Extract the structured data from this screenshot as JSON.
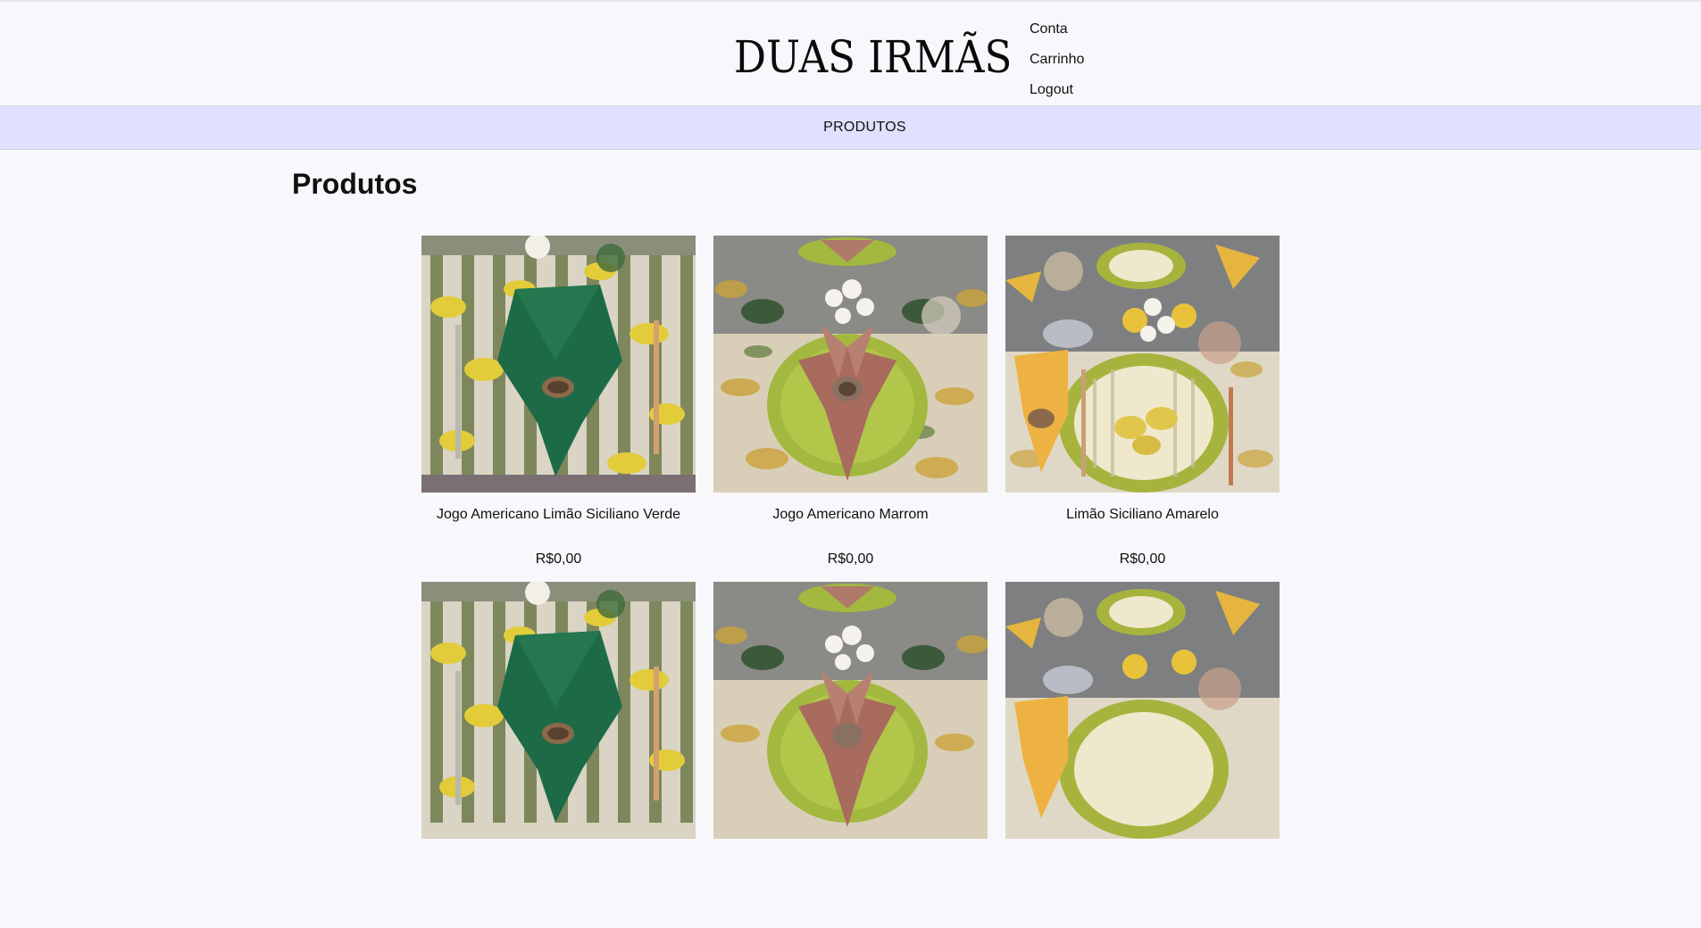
{
  "header": {
    "brand": "DUAS IRMÃS",
    "menu": [
      {
        "label": "Conta"
      },
      {
        "label": "Carrinho"
      },
      {
        "label": "Logout"
      }
    ]
  },
  "nav": {
    "items": [
      {
        "label": "PRODUTOS"
      }
    ]
  },
  "main": {
    "title": "Produtos",
    "products": [
      {
        "name": "Jogo Americano Limão Siciliano Verde",
        "price": "R$0,00",
        "image": "green-napkin-lemon-placemat"
      },
      {
        "name": "Jogo Americano Marrom",
        "price": "R$0,00",
        "image": "brown-napkin-green-plate"
      },
      {
        "name": "Limão Siciliano Amarelo",
        "price": "R$0,00",
        "image": "yellow-napkin-lemon-plate"
      },
      {
        "name": "",
        "price": "",
        "image": "green-napkin-lemon-placemat"
      },
      {
        "name": "",
        "price": "",
        "image": "brown-napkin-green-plate"
      },
      {
        "name": "",
        "price": "",
        "image": "yellow-napkin-lemon-plate"
      }
    ]
  },
  "colors": {
    "page_bg": "#f8f8fc",
    "nav_bg": "#e0e0ff"
  }
}
